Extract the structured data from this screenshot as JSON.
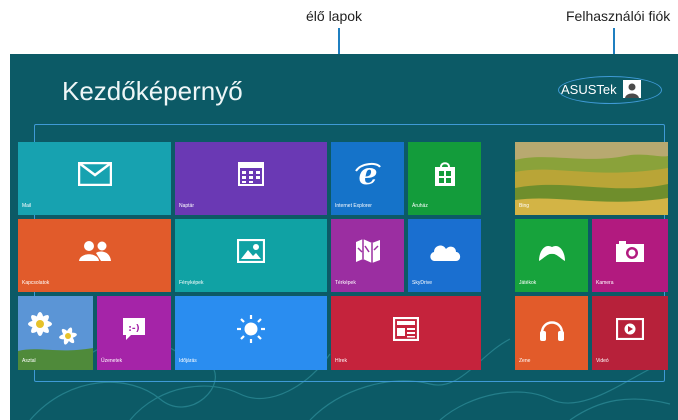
{
  "callouts": {
    "live_tiles": "élő lapok",
    "user_account": "Felhasználói fiók",
    "line_color": "#1f7fc0"
  },
  "start_screen": {
    "title": "Kezdőképernyő",
    "background": "#0c5a66",
    "user": {
      "name": "ASUSTek",
      "icon": "user-avatar-icon"
    }
  },
  "tiles": [
    {
      "id": "mail",
      "label": "Mail",
      "icon": "mail-icon",
      "color": "#17a2b0"
    },
    {
      "id": "calendar",
      "label": "Naptár",
      "icon": "calendar-icon",
      "color": "#6a39b4"
    },
    {
      "id": "ie",
      "label": "Internet Explorer",
      "icon": "internet-explorer-icon",
      "color": "#1573c9"
    },
    {
      "id": "store",
      "label": "Áruház",
      "icon": "store-icon",
      "color": "#139c3b"
    },
    {
      "id": "bing",
      "label": "Bing",
      "icon": "landscape-photo",
      "color": "#a9b14a"
    },
    {
      "id": "people",
      "label": "Kapcsolatok",
      "icon": "people-icon",
      "color": "#e15b2b"
    },
    {
      "id": "photos",
      "label": "Fényképek",
      "icon": "photos-icon",
      "color": "#10a2a4"
    },
    {
      "id": "maps",
      "label": "Térképek",
      "icon": "maps-icon",
      "color": "#9b2ea1"
    },
    {
      "id": "skydrive",
      "label": "SkyDrive",
      "icon": "cloud-icon",
      "color": "#1a6fd0"
    },
    {
      "id": "games",
      "label": "Játékok",
      "icon": "gamepad-icon",
      "color": "#17a33c"
    },
    {
      "id": "camera",
      "label": "Kamera",
      "icon": "camera-icon",
      "color": "#b21a7f"
    },
    {
      "id": "desktop",
      "label": "Asztal",
      "icon": "daisy-wallpaper",
      "color": "#4d8dd0"
    },
    {
      "id": "messaging",
      "label": "Üzenetek",
      "icon": "messaging-icon",
      "color": "#a524a8"
    },
    {
      "id": "weather",
      "label": "Időjárás",
      "icon": "sun-icon",
      "color": "#2a8df0"
    },
    {
      "id": "news",
      "label": "Hírek",
      "icon": "news-icon",
      "color": "#c5233c"
    },
    {
      "id": "music",
      "label": "Zene",
      "icon": "headphones-icon",
      "color": "#e25b2a"
    },
    {
      "id": "video",
      "label": "Videó",
      "icon": "video-icon",
      "color": "#b7213a"
    }
  ]
}
